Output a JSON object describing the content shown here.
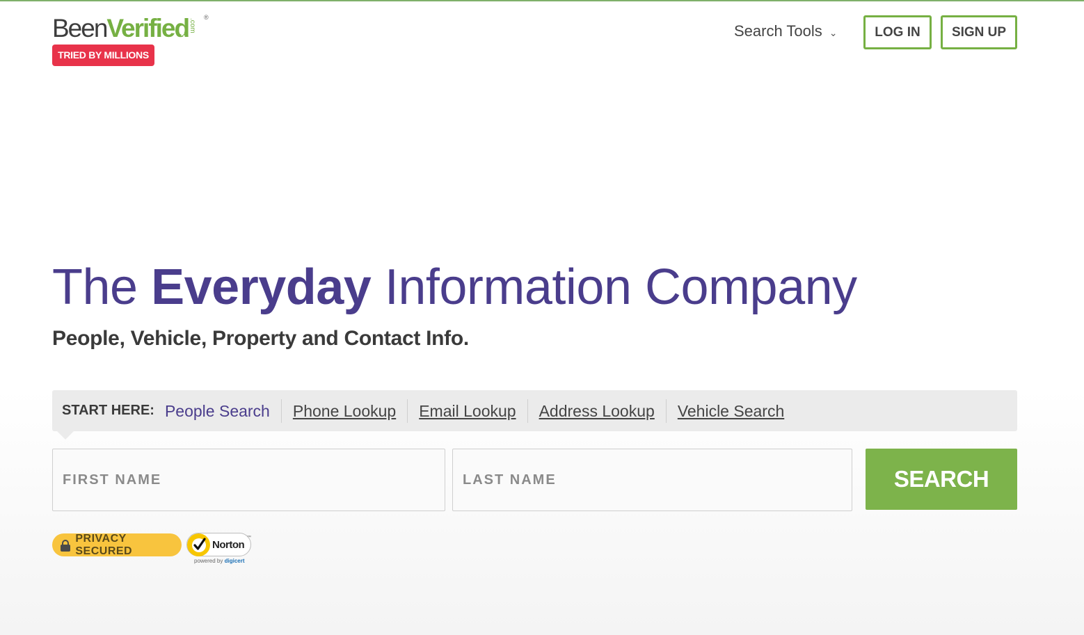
{
  "header": {
    "logo": {
      "been": "Been",
      "verified": "Verified",
      "com": ".com",
      "reg": "®",
      "badge": "TRIED BY MILLIONS"
    },
    "nav": {
      "search_tools": "Search Tools"
    },
    "login_label": "LOG IN",
    "signup_label": "SIGN UP"
  },
  "hero": {
    "headline_pre": "The ",
    "headline_bold": "Everyday",
    "headline_post": " Information Company",
    "subhead": "People, Vehicle, Property and Contact Info."
  },
  "search": {
    "start_label": "START HERE:",
    "tabs": [
      {
        "label": "People Search",
        "active": true
      },
      {
        "label": "Phone Lookup",
        "active": false
      },
      {
        "label": "Email Lookup",
        "active": false
      },
      {
        "label": "Address Lookup",
        "active": false
      },
      {
        "label": "Vehicle Search",
        "active": false
      }
    ],
    "first_name": {
      "placeholder": "FIRST NAME",
      "value": ""
    },
    "last_name": {
      "placeholder": "LAST NAME",
      "value": ""
    },
    "button_label": "SEARCH"
  },
  "badges": {
    "privacy": "PRIVACY SECURED",
    "norton": {
      "name": "Norton",
      "tm": "™",
      "powered_by": "powered by",
      "digicert": "digicert"
    }
  },
  "icons": {
    "lock": "lock-icon",
    "chevron": "chevron-down-icon",
    "norton_check": "checkmark-icon"
  },
  "colors": {
    "brand_purple": "#4a3d8c",
    "brand_green": "#76b043",
    "badge_red": "#e8334a",
    "privacy_yellow": "#f8c43e"
  }
}
